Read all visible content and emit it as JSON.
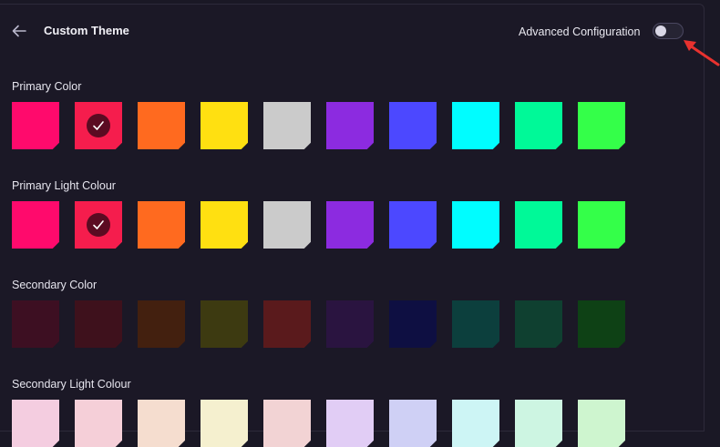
{
  "header": {
    "title": "Custom Theme",
    "advanced_label": "Advanced Configuration",
    "advanced_enabled": false
  },
  "icons": {
    "back": "arrow-left-icon",
    "check": "check-icon",
    "annotation": "red-arrow"
  },
  "sections": [
    {
      "label": "Primary Color",
      "selected_index": 1,
      "colors": [
        "#ff0a6c",
        "#f51d4d",
        "#ff6a1f",
        "#ffe011",
        "#cbcbcb",
        "#8c2be0",
        "#4c48ff",
        "#00fdff",
        "#00f998",
        "#34ff49"
      ]
    },
    {
      "label": "Primary Light Colour",
      "selected_index": 1,
      "colors": [
        "#ff0a6c",
        "#f51d4d",
        "#ff6a1f",
        "#ffe011",
        "#cbcbcb",
        "#8c2be0",
        "#4c48ff",
        "#00fdff",
        "#00f998",
        "#34ff49"
      ]
    },
    {
      "label": "Secondary Color",
      "selected_index": -1,
      "colors": [
        "#3d0f22",
        "#3e111c",
        "#43200f",
        "#3d3a11",
        "#5a1a1c",
        "#2a1440",
        "#0e0f42",
        "#0c3f3d",
        "#0f4030",
        "#0e4115"
      ]
    },
    {
      "label": "Secondary Light Colour",
      "selected_index": -1,
      "colors": [
        "#f4cde0",
        "#f5cfd8",
        "#f5ddcf",
        "#f5f0cf",
        "#f2d3d4",
        "#e1cdf5",
        "#cfd0f5",
        "#cdf5f5",
        "#cdf5e2",
        "#cef5cf"
      ]
    }
  ]
}
